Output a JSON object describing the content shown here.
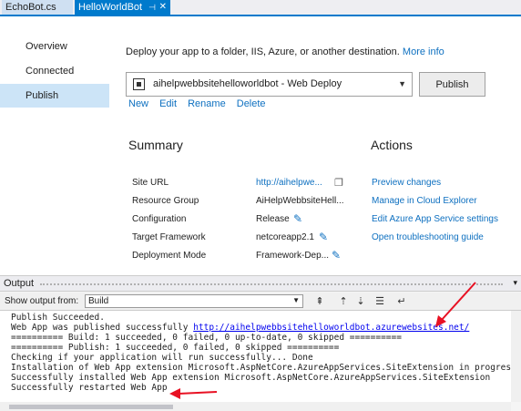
{
  "tabs": [
    {
      "label": "EchoBot.cs"
    },
    {
      "label": "HelloWorldBot"
    }
  ],
  "nav": {
    "items": [
      {
        "label": "Overview"
      },
      {
        "label": "Connected Services"
      },
      {
        "label": "Publish"
      }
    ]
  },
  "deploy": {
    "text": "Deploy your app to a folder, IIS, Azure, or another destination.",
    "more_info": "More info"
  },
  "profile": {
    "selected": "aihelpwebbsitehelloworldbot - Web Deploy"
  },
  "publish_button": "Publish",
  "profile_links": [
    "New",
    "Edit",
    "Rename",
    "Delete"
  ],
  "summary": {
    "title": "Summary",
    "rows": [
      {
        "label": "Site URL",
        "value": "http://aihelpwe..."
      },
      {
        "label": "Resource Group",
        "value": "AiHelpWebbsiteHell..."
      },
      {
        "label": "Configuration",
        "value": "Release"
      },
      {
        "label": "Target Framework",
        "value": "netcoreapp2.1"
      },
      {
        "label": "Deployment Mode",
        "value": "Framework-Dep..."
      }
    ]
  },
  "actions": {
    "title": "Actions",
    "items": [
      "Preview changes",
      "Manage in Cloud Explorer",
      "Edit Azure App Service settings",
      "Open troubleshooting guide"
    ]
  },
  "output": {
    "title": "Output",
    "show_from_label": "Show output from:",
    "show_from_value": "Build",
    "lines": [
      "Publish Succeeded.",
      "Web App was published successfully ",
      "========== Build: 1 succeeded, 0 failed, 0 up-to-date, 0 skipped ==========",
      "========== Publish: 1 succeeded, 0 failed, 0 skipped ==========",
      "Checking if your application will run successfully... Done",
      "Installation of Web App extension Microsoft.AspNetCore.AzureAppServices.SiteExtension in progress",
      "Successfully installed Web App extension Microsoft.AspNetCore.AzureAppServices.SiteExtension",
      "Successfully restarted Web App"
    ],
    "url": "http://aihelpwebbsitehelloworldbot.azurewebsites.net/"
  },
  "colors": {
    "accent": "#007acc",
    "link": "#0e70c0",
    "annotation_arrow": "#e81123"
  }
}
